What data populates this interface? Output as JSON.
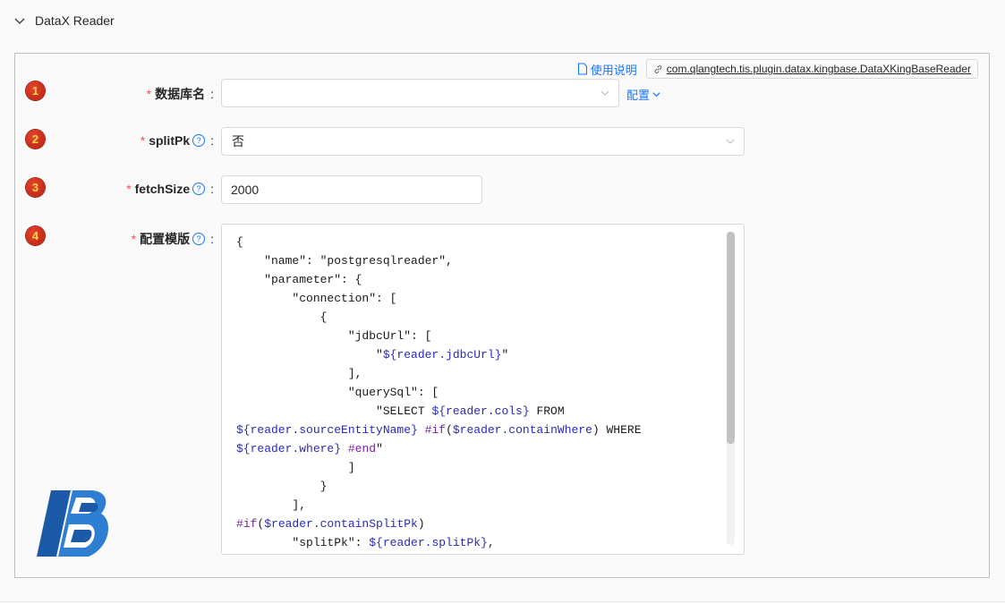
{
  "section": {
    "title": "DataX Reader"
  },
  "top": {
    "doc_link": "使用说明",
    "class_link": "com.qlangtech.tis.plugin.datax.kingbase.DataXKingBaseReader"
  },
  "fields": [
    {
      "step": "1",
      "label": "数据库名",
      "value": "",
      "config_link": "配置"
    },
    {
      "step": "2",
      "label": "splitPk",
      "value": "否"
    },
    {
      "step": "3",
      "label": "fetchSize",
      "value": "2000"
    },
    {
      "step": "4",
      "label": "配置模版"
    }
  ],
  "required_mark": "*",
  "colon": ":",
  "template_lines": [
    "{",
    "    \"name\": \"postgresqlreader\",",
    "    \"parameter\": {",
    "        \"connection\": [",
    "            {",
    "                \"jdbcUrl\": [",
    "                    \"${reader.jdbcUrl}\"",
    "                ],",
    "                \"querySql\": [",
    "                    \"SELECT ${reader.cols} FROM",
    "${reader.sourceEntityName} #if($reader.containWhere) WHERE",
    "${reader.where} #end\"",
    "                ]",
    "            }",
    "        ],",
    "#if($reader.containSplitPk)",
    "        \"splitPk\": ${reader.splitPk},"
  ],
  "colors": {
    "accent": "#1677ff",
    "required": "#ff4d4f",
    "badge": "#d6321c"
  }
}
